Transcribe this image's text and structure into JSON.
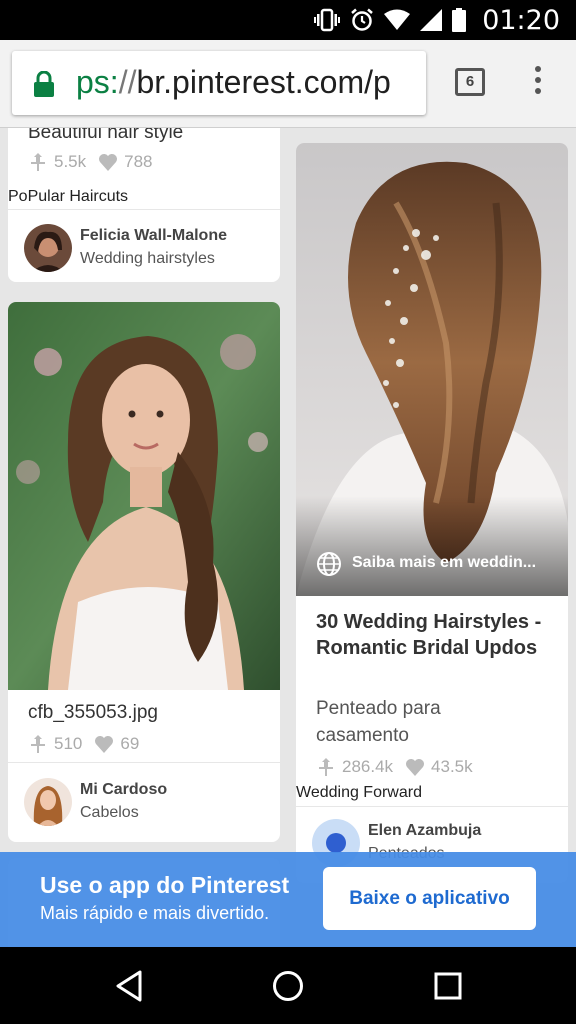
{
  "status_bar": {
    "time": "01:20",
    "icons": [
      "vibrate-icon",
      "alarm-icon",
      "wifi-icon",
      "signal-icon",
      "battery-icon"
    ]
  },
  "browser": {
    "url_scheme": "ps:",
    "url_sep": "//",
    "url_host": "br.pinterest.com/p",
    "tab_count": "6",
    "accent_secure": "#0b8043"
  },
  "pins": {
    "top_left": {
      "title": "Beautiful hair style",
      "repins": "5.5k",
      "likes": "788",
      "source": "PoPular Haircuts",
      "pinner_name": "Felicia Wall-Malone",
      "board": "Wedding hairstyles"
    },
    "middle_left": {
      "title": "cfb_355053.jpg",
      "repins": "510",
      "likes": "69",
      "pinner_name": "Mi Cardoso",
      "board": "Cabelos"
    },
    "right": {
      "overlay": "Saiba mais em weddin...",
      "title": "30 Wedding Hairstyles - Romantic Bridal Updos",
      "description": "Penteado para casamento",
      "repins": "286.4k",
      "likes": "43.5k",
      "source": "Wedding Forward",
      "pinner_name": "Elen Azambuja",
      "board": "Penteados"
    }
  },
  "banner": {
    "title": "Use o app do Pinterest",
    "subtitle": "Mais rápido e mais divertido.",
    "button": "Baixe o aplicativo",
    "color": "#468ce6"
  },
  "nav": {
    "icons": [
      "back-icon",
      "home-icon",
      "recents-icon"
    ]
  }
}
